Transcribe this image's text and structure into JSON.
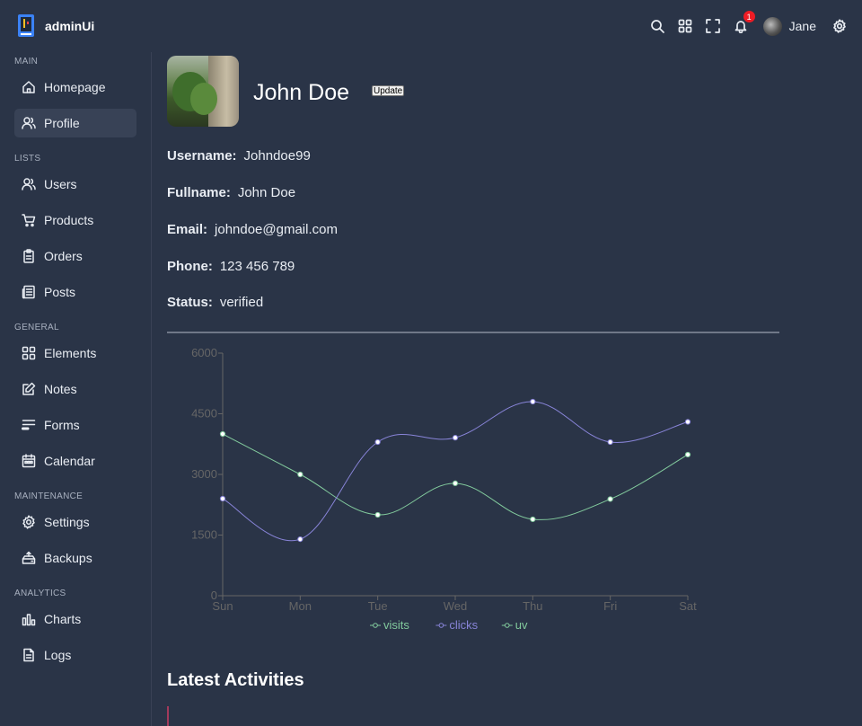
{
  "app": {
    "brand": "adminUi"
  },
  "topbar": {
    "notification_count": "1",
    "user_name": "Jane"
  },
  "sidebar": {
    "groups": [
      {
        "title": "MAIN",
        "items": [
          {
            "label": "Homepage",
            "icon": "home-icon"
          },
          {
            "label": "Profile",
            "icon": "user-icon",
            "active": true
          }
        ]
      },
      {
        "title": "LISTS",
        "items": [
          {
            "label": "Users",
            "icon": "users-icon"
          },
          {
            "label": "Products",
            "icon": "cart-icon"
          },
          {
            "label": "Orders",
            "icon": "clipboard-icon"
          },
          {
            "label": "Posts",
            "icon": "newspaper-icon"
          }
        ]
      },
      {
        "title": "GENERAL",
        "items": [
          {
            "label": "Elements",
            "icon": "grid-icon"
          },
          {
            "label": "Notes",
            "icon": "edit-icon"
          },
          {
            "label": "Forms",
            "icon": "forms-icon"
          },
          {
            "label": "Calendar",
            "icon": "calendar-icon"
          }
        ]
      },
      {
        "title": "MAINTENANCE",
        "items": [
          {
            "label": "Settings",
            "icon": "gear-icon"
          },
          {
            "label": "Backups",
            "icon": "backup-icon"
          }
        ]
      },
      {
        "title": "ANALYTICS",
        "items": [
          {
            "label": "Charts",
            "icon": "bar-chart-icon"
          },
          {
            "label": "Logs",
            "icon": "document-icon"
          }
        ]
      }
    ]
  },
  "profile": {
    "name": "John Doe",
    "update_label": "Update",
    "fields": [
      {
        "label": "Username:",
        "value": "Johndoe99"
      },
      {
        "label": "Fullname:",
        "value": "John Doe"
      },
      {
        "label": "Email:",
        "value": "johndoe@gmail.com"
      },
      {
        "label": "Phone:",
        "value": "123 456 789"
      },
      {
        "label": "Status:",
        "value": "verified"
      }
    ]
  },
  "chart_data": {
    "type": "line",
    "categories": [
      "Sun",
      "Mon",
      "Tue",
      "Wed",
      "Thu",
      "Fri",
      "Sat"
    ],
    "series": [
      {
        "name": "visits",
        "color": "#82ca9d",
        "values": [
          4000,
          3000,
          2000,
          2780,
          1890,
          2390,
          3490
        ]
      },
      {
        "name": "clicks",
        "color": "#8884d8",
        "values": [
          2400,
          1398,
          3800,
          3908,
          4800,
          3800,
          4300
        ]
      },
      {
        "name": "uv",
        "color": "#82ca9d",
        "values": []
      }
    ],
    "yticks": [
      0,
      1500,
      3000,
      4500,
      6000
    ],
    "ylim": [
      0,
      6000
    ],
    "grid": false,
    "legend": "bottom"
  },
  "activities": {
    "title": "Latest Activities"
  }
}
